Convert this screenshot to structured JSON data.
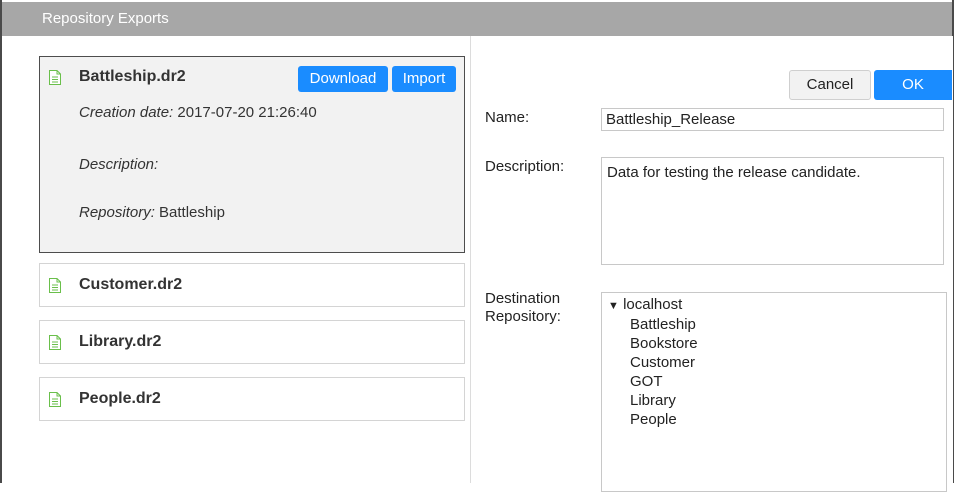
{
  "window": {
    "title": "Repository Exports"
  },
  "exports": {
    "selected": {
      "name": "Battleship.dr2",
      "download_label": "Download",
      "import_label": "Import",
      "creation_label": "Creation date:",
      "creation_value": "2017-07-20 21:26:40",
      "description_label": "Description:",
      "description_value": "",
      "repository_label": "Repository:",
      "repository_value": "Battleship"
    },
    "items": [
      {
        "name": "Customer.dr2"
      },
      {
        "name": "Library.dr2"
      },
      {
        "name": "People.dr2"
      }
    ]
  },
  "form": {
    "cancel_label": "Cancel",
    "ok_label": "OK",
    "name_label": "Name:",
    "name_value": "Battleship_Release",
    "description_label": "Description:",
    "description_value": "Data for testing the release candidate.",
    "destination_label_1": "Destination",
    "destination_label_2": "Repository:",
    "tree": {
      "root": "localhost",
      "children": [
        "Battleship",
        "Bookstore",
        "Customer",
        "GOT",
        "Library",
        "People"
      ]
    }
  },
  "colors": {
    "accent": "#1a8cff",
    "titlebar": "#a7a7a7",
    "selected_bg": "#f2f2f2",
    "file_icon": "#6abf4b"
  }
}
